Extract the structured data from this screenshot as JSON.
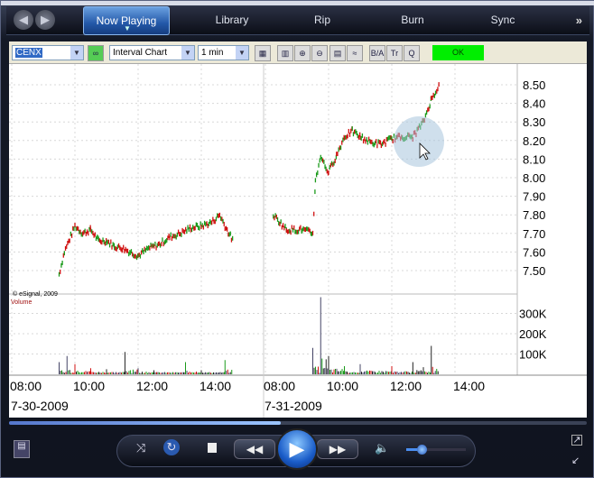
{
  "nav": {
    "tabs": [
      "Now Playing",
      "Library",
      "Rip",
      "Burn",
      "Sync"
    ],
    "active": "Now Playing",
    "more": "»"
  },
  "toolbar": {
    "symbol": "CENX",
    "chart_type": "Interval Chart",
    "interval": "1 min",
    "ok_label": "OK",
    "ok_color": "#00ee00",
    "icons": [
      "bar-chart-icon",
      "bar-style-icon",
      "zoom-in-icon",
      "zoom-out-icon",
      "table-icon",
      "study-icon",
      "bid-ask-icon",
      "trade-icon",
      "quote-icon"
    ]
  },
  "chart": {
    "copyright": "© eSignal, 2009",
    "volume_label": "Volume",
    "price_ticks": [
      "8.50",
      "8.40",
      "8.30",
      "8.20",
      "8.10",
      "8.00",
      "7.90",
      "7.80",
      "7.70",
      "7.60",
      "7.50"
    ],
    "volume_ticks": [
      "300K",
      "200K",
      "100K"
    ],
    "time_ticks": [
      [
        "08:00",
        "10:00",
        "12:00",
        "14:00"
      ],
      [
        "08:00",
        "10:00",
        "12:00",
        "14:00"
      ]
    ],
    "dates": [
      "7-30-2009",
      "7-31-2009"
    ],
    "colors": {
      "up": "#1a9a1a",
      "down": "#d01010",
      "grid": "#d8d8d8"
    },
    "days": [
      {
        "price": [
          [
            "09:30",
            7.48
          ],
          [
            "09:40",
            7.6
          ],
          [
            "09:50",
            7.67
          ],
          [
            "10:00",
            7.74
          ],
          [
            "10:15",
            7.7
          ],
          [
            "10:30",
            7.72
          ],
          [
            "10:45",
            7.66
          ],
          [
            "11:00",
            7.66
          ],
          [
            "11:15",
            7.63
          ],
          [
            "11:30",
            7.62
          ],
          [
            "11:45",
            7.6
          ],
          [
            "12:00",
            7.58
          ],
          [
            "12:20",
            7.62
          ],
          [
            "12:40",
            7.64
          ],
          [
            "13:00",
            7.68
          ],
          [
            "13:20",
            7.7
          ],
          [
            "13:40",
            7.73
          ],
          [
            "14:00",
            7.74
          ],
          [
            "14:20",
            7.76
          ],
          [
            "14:35",
            7.8
          ],
          [
            "14:45",
            7.74
          ],
          [
            "15:00",
            7.66
          ]
        ],
        "volume": [
          [
            "09:30",
            60
          ],
          [
            "09:45",
            90
          ],
          [
            "10:00",
            50
          ],
          [
            "10:30",
            30
          ],
          [
            "11:00",
            25
          ],
          [
            "11:35",
            110
          ],
          [
            "12:00",
            30
          ],
          [
            "12:30",
            20
          ],
          [
            "13:30",
            60
          ],
          [
            "14:00",
            20
          ],
          [
            "14:45",
            70
          ],
          [
            "15:00",
            40
          ]
        ]
      },
      {
        "price": [
          [
            "08:15",
            7.8
          ],
          [
            "08:40",
            7.72
          ],
          [
            "09:10",
            7.72
          ],
          [
            "09:30",
            7.7
          ],
          [
            "09:35",
            7.98
          ],
          [
            "09:45",
            8.12
          ],
          [
            "09:55",
            8.05
          ],
          [
            "10:00",
            8.03
          ],
          [
            "10:15",
            8.12
          ],
          [
            "10:30",
            8.22
          ],
          [
            "10:45",
            8.25
          ],
          [
            "11:00",
            8.22
          ],
          [
            "11:20",
            8.19
          ],
          [
            "11:40",
            8.18
          ],
          [
            "12:00",
            8.21
          ],
          [
            "12:20",
            8.22
          ],
          [
            "12:40",
            8.22
          ],
          [
            "13:00",
            8.3
          ],
          [
            "13:15",
            8.42
          ],
          [
            "13:30",
            8.5
          ]
        ],
        "volume": [
          [
            "09:30",
            130
          ],
          [
            "09:45",
            380
          ],
          [
            "10:00",
            90
          ],
          [
            "10:30",
            40
          ],
          [
            "11:00",
            50
          ],
          [
            "12:00",
            40
          ],
          [
            "12:40",
            60
          ],
          [
            "13:00",
            35
          ],
          [
            "13:15",
            140
          ],
          [
            "13:30",
            60
          ]
        ]
      }
    ]
  },
  "player": {
    "progress": 0.47,
    "volume": 0.25
  }
}
